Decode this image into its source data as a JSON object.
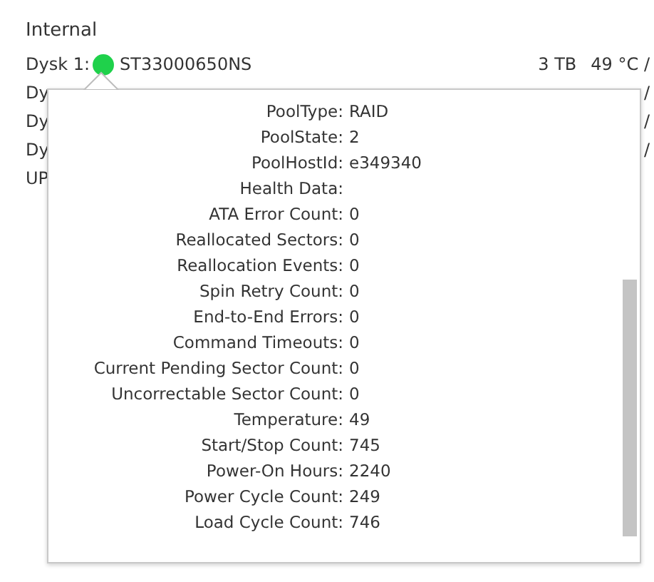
{
  "section": "Internal",
  "disks": [
    {
      "label": "Dysk 1:",
      "color": "#1fd14b",
      "model": "ST33000650NS",
      "size": "3 TB",
      "temp": "49 °C /"
    },
    {
      "label": "Dy",
      "temp": "/"
    },
    {
      "label": "Dy",
      "temp": "/"
    },
    {
      "label": "Dy",
      "temp": "/"
    },
    {
      "label": "UP"
    }
  ],
  "popup": {
    "rows": [
      {
        "label": "PoolType:",
        "value": "RAID"
      },
      {
        "label": "PoolState:",
        "value": "2"
      },
      {
        "label": "PoolHostId:",
        "value": "e349340"
      },
      {
        "label": "Health Data:"
      },
      {
        "label": "ATA Error Count:",
        "value": "0"
      },
      {
        "label": "Reallocated Sectors:",
        "value": "0"
      },
      {
        "label": "Reallocation Events:",
        "value": "0"
      },
      {
        "label": "Spin Retry Count:",
        "value": "0"
      },
      {
        "label": "End-to-End Errors:",
        "value": "0"
      },
      {
        "label": "Command Timeouts:",
        "value": "0"
      },
      {
        "label": "Current Pending Sector Count:",
        "value": "0"
      },
      {
        "label": "Uncorrectable Sector Count:",
        "value": "0"
      },
      {
        "label": "Temperature:",
        "value": "49"
      },
      {
        "label": "Start/Stop Count:",
        "value": "745"
      },
      {
        "label": "Power-On Hours:",
        "value": "2240"
      },
      {
        "label": "Power Cycle Count:",
        "value": "249"
      },
      {
        "label": "Load Cycle Count:",
        "value": "746"
      }
    ]
  }
}
